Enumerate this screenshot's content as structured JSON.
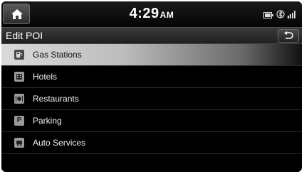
{
  "status": {
    "home_icon": "home-icon",
    "time": "4:29",
    "ampm": "AM",
    "icons": [
      "battery-icon",
      "bluetooth-icon",
      "signal-icon"
    ]
  },
  "header": {
    "title": "Edit POI",
    "back_icon": "back-arrow-icon"
  },
  "list": {
    "items": [
      {
        "label": "Gas Stations",
        "icon": "gas-station-icon",
        "selected": true
      },
      {
        "label": "Hotels",
        "icon": "hotel-icon",
        "selected": false
      },
      {
        "label": "Restaurants",
        "icon": "restaurant-icon",
        "selected": false
      },
      {
        "label": "Parking",
        "icon": "parking-icon",
        "icon_text": "P",
        "selected": false
      },
      {
        "label": "Auto Services",
        "icon": "auto-service-icon",
        "selected": false
      }
    ]
  }
}
